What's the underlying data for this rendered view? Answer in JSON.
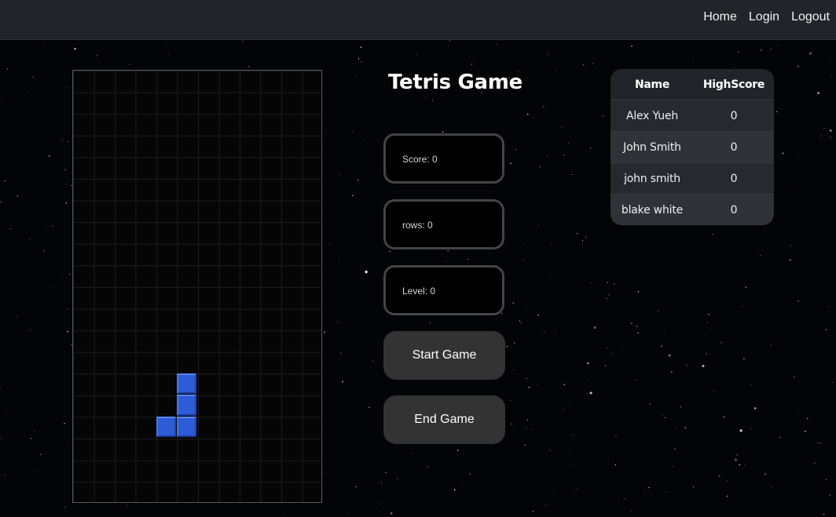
{
  "nav": {
    "links": [
      "Home",
      "Login",
      "Logout"
    ]
  },
  "game": {
    "title": "Tetris Game",
    "score_label": "Score: 0",
    "rows_label": "rows: 0",
    "level_label": "Level: 0",
    "start_label": "Start Game",
    "end_label": "End Game",
    "block_color": "#2e5bd6",
    "board_cols": 12,
    "board_rows": 20,
    "active_piece_cells": [
      [
        5,
        14
      ],
      [
        5,
        15
      ],
      [
        4,
        16
      ],
      [
        5,
        16
      ]
    ]
  },
  "leaderboard": {
    "headers": [
      "Name",
      "HighScore"
    ],
    "rows": [
      {
        "name": "Alex Yueh",
        "score": "0"
      },
      {
        "name": "John Smith",
        "score": "0"
      },
      {
        "name": "john smith",
        "score": "0"
      },
      {
        "name": "blake white",
        "score": "0"
      }
    ]
  }
}
